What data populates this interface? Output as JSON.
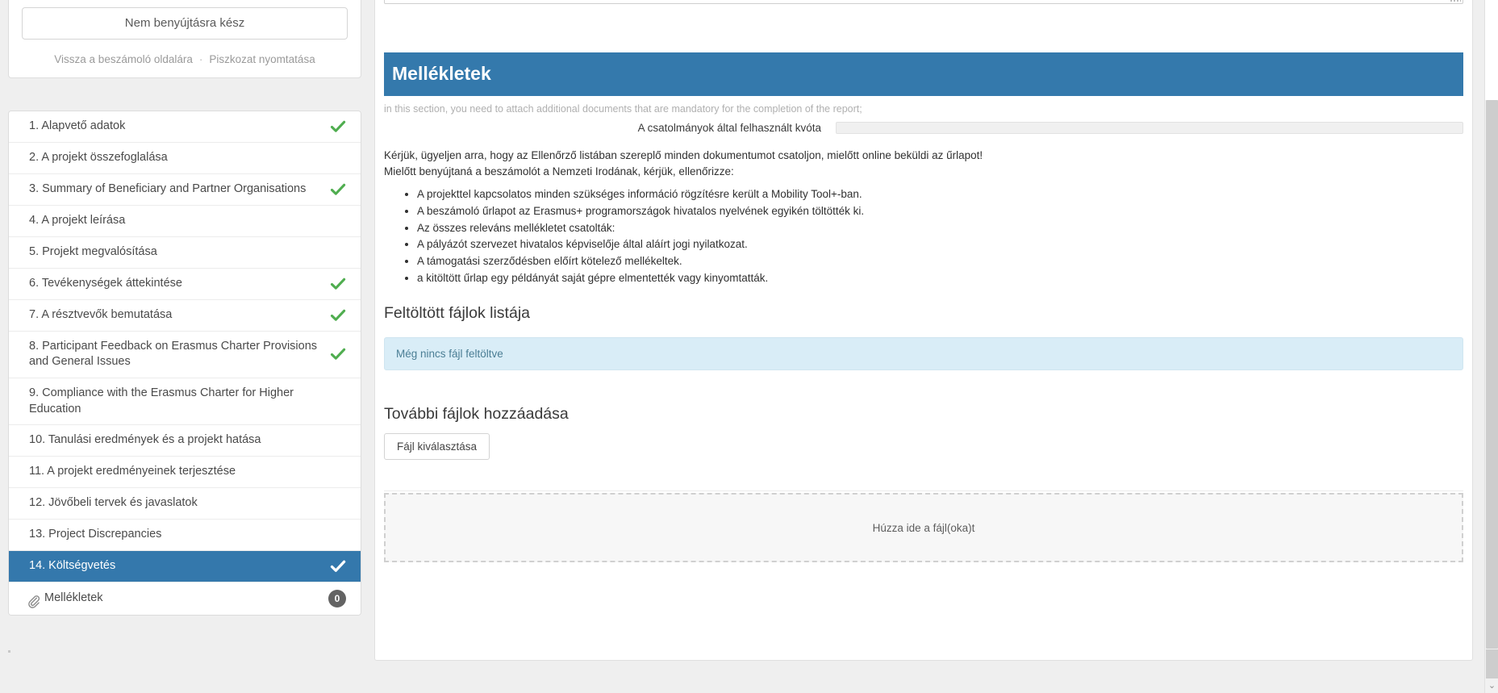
{
  "sidebar": {
    "status_button_label": "Nem benyújtásra kész",
    "links": [
      {
        "label": "Vissza a beszámoló oldalára"
      },
      {
        "label": "Piszkozat nyomtatása"
      }
    ],
    "link_separator": "·",
    "nav_items": [
      {
        "label": "1. Alapvető adatok",
        "complete": true
      },
      {
        "label": "2. A projekt összefoglalása",
        "complete": false
      },
      {
        "label": "3. Summary of Beneficiary and Partner Organisations",
        "complete": true
      },
      {
        "label": "4. A projekt leírása",
        "complete": false
      },
      {
        "label": "5. Projekt megvalósítása",
        "complete": false
      },
      {
        "label": "6. Tevékenységek áttekintése",
        "complete": true
      },
      {
        "label": "7. A résztvevők bemutatása",
        "complete": true
      },
      {
        "label": "8. Participant Feedback on Erasmus Charter Provisions and General Issues",
        "complete": true
      },
      {
        "label": "9. Compliance with the Erasmus Charter for Higher Education",
        "complete": false
      },
      {
        "label": "10. Tanulási eredmények és a projekt hatása",
        "complete": false
      },
      {
        "label": "11. A projekt eredményeinek terjesztése",
        "complete": false
      },
      {
        "label": "12. Jövőbeli tervek és javaslatok",
        "complete": false
      },
      {
        "label": "13. Project Discrepancies",
        "complete": false
      },
      {
        "label": "14. Költségvetés",
        "complete": true,
        "active": true
      }
    ],
    "attachments_item": {
      "label": "Mellékletek",
      "badge": "0"
    }
  },
  "main": {
    "section_title": "Mellékletek",
    "section_note": "in this section, you need to attach additional documents that are mandatory for the completion of the report;",
    "quota": {
      "label": "A csatolmányok által felhasznált kvóta",
      "percent": 0
    },
    "intro_lines": [
      "Kérjük, ügyeljen arra, hogy az Ellenőrző listában szereplő minden dokumentumot csatoljon, mielőtt online beküldi az űrlapot!",
      "Mielőtt benyújtaná a beszámolót a Nemzeti Irodának, kérjük, ellenőrizze:"
    ],
    "checklist": [
      "A projekttel kapcsolatos minden szükséges információ rögzítésre került a Mobility Tool+-ban.",
      "A beszámoló űrlapot az Erasmus+ programországok hivatalos nyelvének egyikén töltötték ki.",
      "Az összes releváns mellékletet csatolták:",
      "A pályázót szervezet hivatalos képviselője által aláírt jogi nyilatkozat.",
      "A támogatási szerződésben előírt kötelező mellékeltek.",
      "a kitöltött űrlap egy példányát saját gépre elmentették vagy kinyomtatták."
    ],
    "uploaded_files_heading": "Feltöltött fájlok listája",
    "no_files_message": "Még nincs fájl feltöltve",
    "add_files_heading": "További fájlok hozzáadása",
    "choose_file_button": "Fájl kiválasztása",
    "dropzone_text": "Húzza ide a fájl(oka)t"
  },
  "scrollbar": {
    "down_arrow_glyph": "⌄"
  },
  "colors": {
    "accent_blue": "#3479ac",
    "check_green": "#4fad4f",
    "info_bg": "#d9edf7",
    "badge_gray": "#636363"
  }
}
